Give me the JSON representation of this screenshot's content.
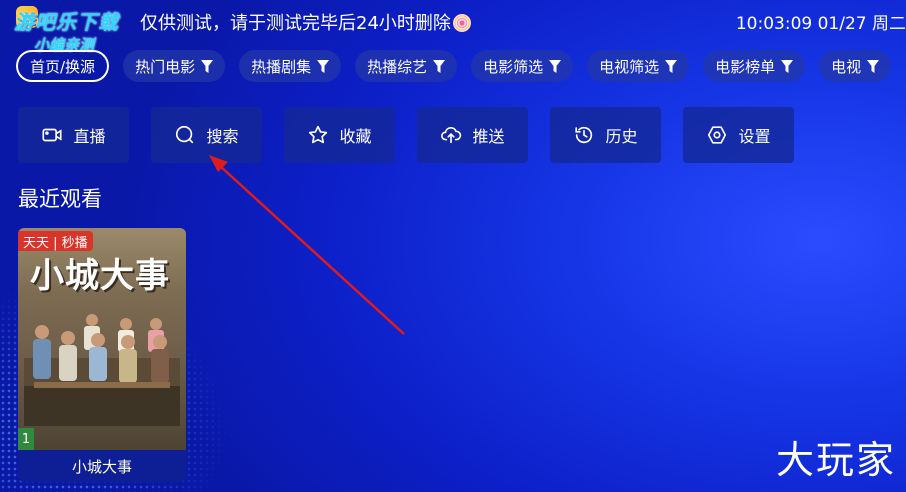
{
  "header": {
    "watermark_title": "游吧乐下载",
    "watermark_subtitle": "小编亲测",
    "notice": "仅供测试，请于测试完毕后24小时删除",
    "clock": "10:03:09 01/27 周二"
  },
  "tabs": [
    {
      "label": "首页/换源",
      "filter": false,
      "active": true
    },
    {
      "label": "热门电影",
      "filter": true,
      "active": false
    },
    {
      "label": "热播剧集",
      "filter": true,
      "active": false
    },
    {
      "label": "热播综艺",
      "filter": true,
      "active": false
    },
    {
      "label": "电影筛选",
      "filter": true,
      "active": false
    },
    {
      "label": "电视筛选",
      "filter": true,
      "active": false
    },
    {
      "label": "电影榜单",
      "filter": true,
      "active": false
    },
    {
      "label": "电视",
      "filter": true,
      "active": false
    }
  ],
  "actions": [
    {
      "label": "直播",
      "icon": "video-camera-icon"
    },
    {
      "label": "搜索",
      "icon": "search-icon"
    },
    {
      "label": "收藏",
      "icon": "star-icon"
    },
    {
      "label": "推送",
      "icon": "cloud-upload-icon"
    },
    {
      "label": "历史",
      "icon": "history-icon"
    },
    {
      "label": "设置",
      "icon": "settings-icon"
    }
  ],
  "recent": {
    "title": "最近观看",
    "items": [
      {
        "title": "小城大事",
        "poster_title": "小城大事",
        "poster_tag": "天天 | 秒播",
        "episode": "1"
      }
    ]
  },
  "corner_mark": "大玩家",
  "colors": {
    "accent": "#1636e6",
    "arrow": "#e01b1b"
  }
}
